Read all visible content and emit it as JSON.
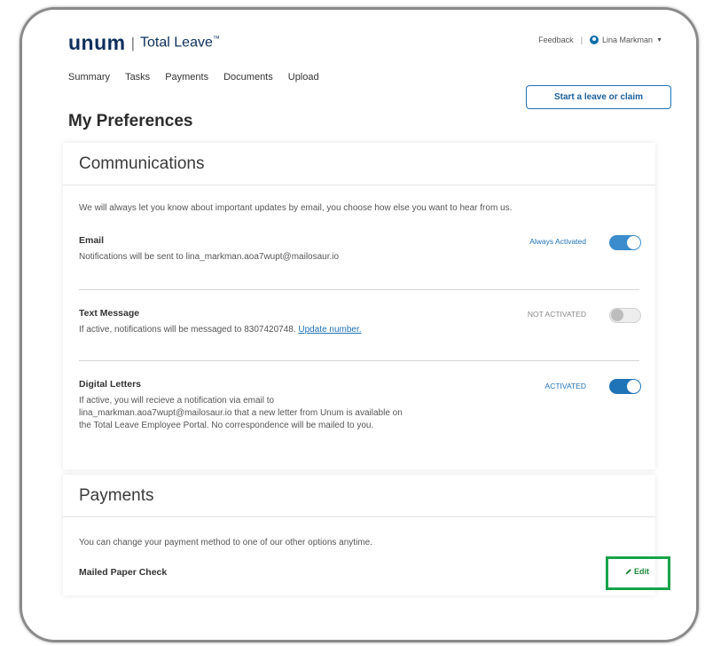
{
  "header": {
    "logo_text": "unum",
    "logo_separator": "|",
    "product_name": "Total Leave",
    "product_mark": "™",
    "feedback": "Feedback",
    "divider": "|",
    "user_name": "Lina Markman"
  },
  "nav": [
    "Summary",
    "Tasks",
    "Payments",
    "Documents",
    "Upload"
  ],
  "start_button": "Start a leave or claim",
  "page_title": "My Preferences",
  "communications": {
    "title": "Communications",
    "intro": "We will always let you know about important updates by email, you choose how else you want to hear from us.",
    "email": {
      "title": "Email",
      "desc": "Notifications will be sent to lina_markman.aoa7wupt@mailosaur.io",
      "status": "Always Activated",
      "enabled": true
    },
    "text": {
      "title": "Text Message",
      "desc": "If active, notifications will be messaged to 8307420748.",
      "link": "Update number.",
      "status": "NOT ACTIVATED",
      "enabled": false
    },
    "letters": {
      "title": "Digital Letters",
      "desc": "If active, you will recieve a notification via email to lina_markman.aoa7wupt@mailosaur.io that a new letter from Unum is available on the Total Leave Employee Portal. No correspondence will be mailed to you.",
      "status": "ACTIVATED",
      "enabled": true
    }
  },
  "payments": {
    "title": "Payments",
    "intro": "You can change your payment method to one of our other options anytime.",
    "method": "Mailed Paper Check",
    "edit": "Edit"
  },
  "colors": {
    "brand_navy": "#0d2f5c",
    "accent_blue": "#1f73b7",
    "highlight_green": "#16a34a"
  }
}
